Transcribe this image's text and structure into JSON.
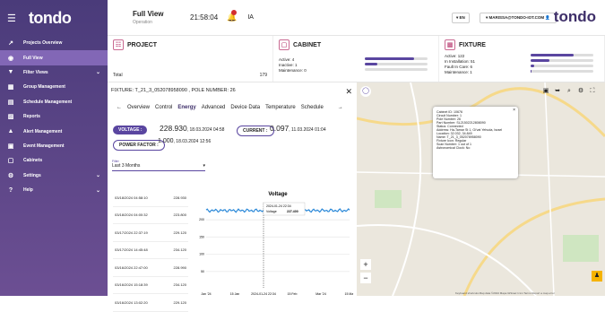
{
  "sidebar": {
    "logo": "tondo",
    "items": [
      {
        "label": "Projects Overview",
        "icon": "chart-icon",
        "chev": false,
        "active": false
      },
      {
        "label": "Full View",
        "icon": "pin-icon",
        "chev": false,
        "active": true
      },
      {
        "label": "Filter Views",
        "icon": "filter-icon",
        "chev": true,
        "active": false
      },
      {
        "label": "Group Management",
        "icon": "grid-icon",
        "chev": false,
        "active": false
      },
      {
        "label": "Schedule Management",
        "icon": "calendar-icon",
        "chev": false,
        "active": false
      },
      {
        "label": "Reports",
        "icon": "report-icon",
        "chev": false,
        "active": false
      },
      {
        "label": "Alert Management",
        "icon": "warning-icon",
        "chev": false,
        "active": false
      },
      {
        "label": "Event Management",
        "icon": "event-icon",
        "chev": false,
        "active": false
      },
      {
        "label": "Cabinets",
        "icon": "cabinet-icon",
        "chev": false,
        "active": false
      },
      {
        "label": "Settings",
        "icon": "gear-icon",
        "chev": true,
        "active": false
      },
      {
        "label": "Help",
        "icon": "help-icon",
        "chev": true,
        "active": false
      }
    ]
  },
  "topbar": {
    "title": "Full View",
    "subtitle": "Operation",
    "clock": "21:58:04",
    "ia": "IA",
    "lang": "▾ EN",
    "user": "▾ MARISSA@TONDO-IOT.COM 👤",
    "brand": "tondo"
  },
  "project": {
    "title": "PROJECT",
    "total_label": "Total",
    "total_value": "179"
  },
  "cabinet": {
    "title": "CABINET",
    "rows": [
      {
        "label": "Active: 4",
        "fill": 0.78
      },
      {
        "label": "Inactive: 1",
        "fill": 0.2
      },
      {
        "label": "Maintenance: 0",
        "fill": 0
      }
    ]
  },
  "fixture": {
    "title": "FIXTURE",
    "rows": [
      {
        "label": "Active: 122",
        "fill": 0.68
      },
      {
        "label": "In Installation: 51",
        "fill": 0.3
      },
      {
        "label": "Fault In Care: 6",
        "fill": 0.05
      },
      {
        "label": "Maintenance: 1",
        "fill": 0.01
      }
    ]
  },
  "panel": {
    "header": "FIXTURE: T_21_3_052078958090 , POLE NUMBER: 26",
    "close": "✕",
    "tabs": [
      "Overview",
      "Control",
      "Energy",
      "Advanced",
      "Device Data",
      "Temperature",
      "Schedule"
    ],
    "active_tab": "Energy",
    "voltage_label": "VOLTAGE :",
    "voltage_value": "228.930",
    "voltage_date": ", 18.03.2024 04:58",
    "current_label": "CURRENT :",
    "current_value": "0.097",
    "current_date": ", 11.03.2024 01:04",
    "pf_label": "POWER FACTOR :",
    "pf_value": "1.000",
    "pf_date": ", 18.03.2024 12:56",
    "filter_label": "Filter",
    "filter_value": "Last 3 Months",
    "table": [
      {
        "d": "03/18/2024 04:58:10",
        "v": "228.930"
      },
      {
        "d": "03/18/2024 04:00:32",
        "v": "223.800"
      },
      {
        "d": "03/17/2024 22:37:19",
        "v": "229.120"
      },
      {
        "d": "03/17/2024 14:45:48",
        "v": "234.120"
      },
      {
        "d": "03/16/2024 22:47:00",
        "v": "228.990"
      },
      {
        "d": "03/16/2024 15:18:39",
        "v": "234.120"
      },
      {
        "d": "03/16/2024 13:02:20",
        "v": "229.120"
      }
    ]
  },
  "chart_data": {
    "type": "line",
    "title": "Voltage",
    "tooltip_date": "2024-01-24 22:34",
    "tooltip_label": "Voltage",
    "tooltip_value": "227.400",
    "ylim": [
      0,
      250
    ],
    "y_ticks": [
      "200",
      "150",
      "100",
      "50"
    ],
    "x_ticks": [
      "Jan '24",
      "15 Jan",
      "2024-01-24 22:34",
      "15 Feb",
      "Mar '24",
      "15 Mar"
    ]
  },
  "map": {
    "info": [
      "Cabinet ID: 10676",
      "Circuit Number: 1",
      "Pole Number: 26",
      "Part Number: SL21502212808090",
      "Status: Connected",
      "Address: Ha-Tamar St 1, Gi'vat Yehuda, Israel",
      "Location: 32.032, 34.849",
      "Name: T_21_3_052078958090",
      "Fixture Icon: Regular",
      "Scan Number: 1 out of 1",
      "Astronomical Clock: No"
    ],
    "footer": "Keyboard shortcuts   Map data ©2024 Mapa GISrael   1 km   Terms   Report a map error"
  }
}
